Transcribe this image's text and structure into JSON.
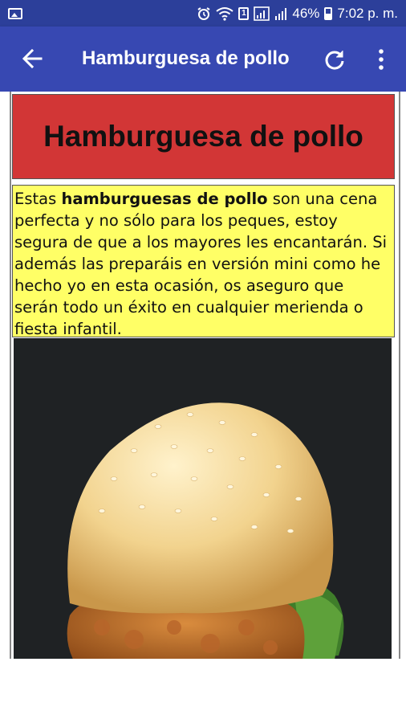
{
  "status_bar": {
    "battery": "46%",
    "time": "7:02 p. m.",
    "sim_badge": "1",
    "icons": [
      "image-icon",
      "alarm-icon",
      "wifi-icon",
      "sim-icon",
      "signal-icon",
      "signal-icon",
      "battery-icon"
    ]
  },
  "app_bar": {
    "title": "Hamburguesa de pollo",
    "icons": [
      "back-arrow-icon",
      "refresh-icon",
      "more-vert-icon"
    ]
  },
  "article": {
    "heading": "Hamburguesa de pollo",
    "intro_before": "Estas ",
    "intro_bold": "hamburguesas de pollo",
    "intro_after": " son una cena perfecta y no sólo para los peques, estoy segura de que a los mayores les encantarán. Si además las preparáis en versión mini como he hecho yo en esta ocasión, os aseguro que serán todo un éxito en cualquier merienda o fiesta infantil."
  },
  "colors": {
    "status_bar": "#2c3f9a",
    "app_bar": "#3748b2",
    "heading_bg": "#d23636",
    "text_bg": "#ffff66",
    "photo_bg": "#1f2224"
  }
}
